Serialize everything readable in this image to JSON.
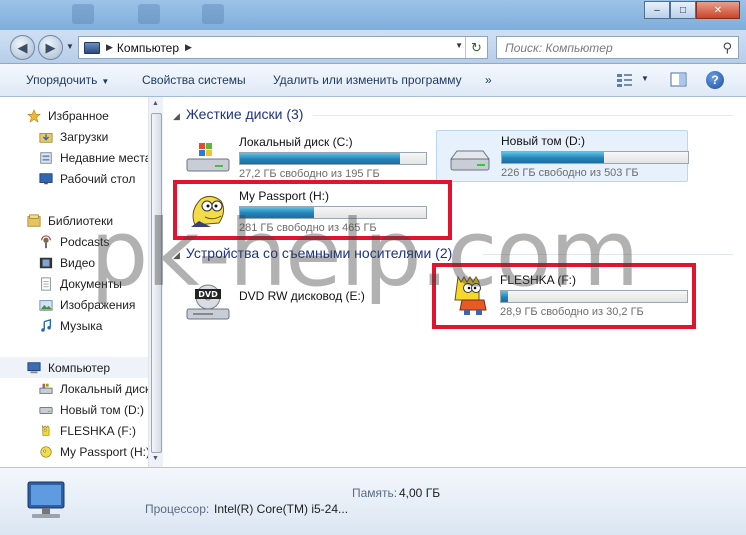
{
  "navigation": {
    "address_crumb": "Компьютер",
    "search_placeholder": "Поиск: Компьютер"
  },
  "toolbar": {
    "organize": "Упорядочить",
    "system_properties": "Свойства системы",
    "uninstall": "Удалить или изменить программу",
    "more": "»"
  },
  "sidebar": {
    "favorites": {
      "label": "Избранное",
      "items": [
        "Загрузки",
        "Недавние места",
        "Рабочий стол"
      ]
    },
    "libraries": {
      "label": "Библиотеки",
      "items": [
        "Podcasts",
        "Видео",
        "Документы",
        "Изображения",
        "Музыка"
      ]
    },
    "computer": {
      "label": "Компьютер",
      "items": [
        "Локальный диск",
        "Новый том (D:)",
        "FLESHKA (F:)",
        "My Passport (H:)"
      ]
    }
  },
  "sections": {
    "hard_drives": "Жесткие диски (3)",
    "removable": "Устройства со съемными носителями (2)"
  },
  "drives": [
    {
      "name": "Локальный диск (C:)",
      "free": "27,2 ГБ свободно из 195 ГБ",
      "used_fraction": 0.86
    },
    {
      "name": "Новый том (D:)",
      "free": "226 ГБ свободно из 503 ГБ",
      "used_fraction": 0.55
    },
    {
      "name": "My Passport (H:)",
      "free": "281 ГБ свободно из 465 ГБ",
      "used_fraction": 0.4
    },
    {
      "name": "DVD RW дисковод (E:)"
    },
    {
      "name": "FLESHKA (F:)",
      "free": "28,9 ГБ свободно из 30,2 ГБ",
      "used_fraction": 0.04
    }
  ],
  "details": {
    "memory_label": "Память:",
    "memory_value": "4,00 ГБ",
    "cpu_label": "Процессор:",
    "cpu_value": "Intel(R) Core(TM) i5-24..."
  },
  "watermark": "pk-help.com",
  "colors": {
    "highlight_box": "#e0142d",
    "progress_fill": "#2583b8",
    "section_title": "#1e3287"
  }
}
